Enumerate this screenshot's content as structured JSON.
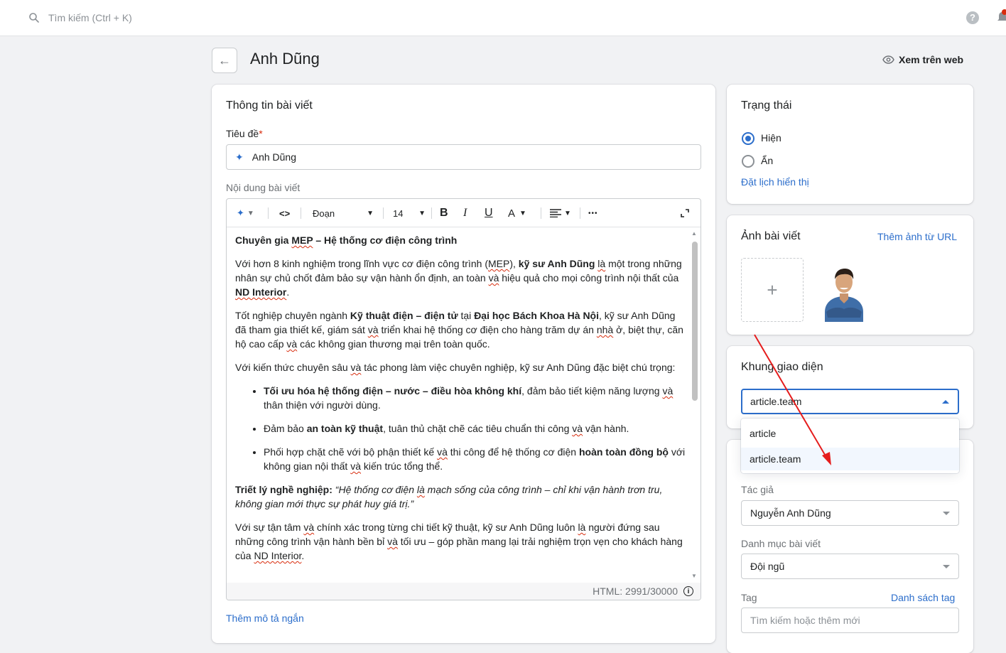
{
  "topbar": {
    "search_placeholder": "Tìm kiếm (Ctrl + K)",
    "help_glyph": "?"
  },
  "header": {
    "back_glyph": "←",
    "title": "Anh Dũng",
    "view_web": "Xem trên web"
  },
  "post_info": {
    "title": "Thông tin bài viết",
    "title_label": "Tiêu đề",
    "title_required": "*",
    "title_value": "Anh Dũng",
    "content_label": "Nội dung bài viết",
    "add_short_desc": "Thêm mô tả ngắn"
  },
  "editor": {
    "toolbar": {
      "ai_glyph": "✦",
      "code_glyph": "<>",
      "block_format": "Đoạn",
      "font_size": "14",
      "bold": "B",
      "italic": "I",
      "underline": "U",
      "color": "A",
      "more": "•••"
    },
    "counter": "HTML: 2991/30000",
    "body": {
      "p0_a": "Chuyên gia ",
      "p0_b": "MEP",
      "p0_c": " – Hệ thống cơ điện công trình",
      "p1_a": "Với hơn 8 kinh nghiệm trong lĩnh vực cơ điện công trình (",
      "p1_b": "MEP",
      "p1_c": "), ",
      "p1_d": "kỹ sư Anh Dũng",
      "p1_e": " ",
      "p1_f": "là",
      "p1_g": " một trong những nhân sự chủ chốt đảm bảo sự vận hành ổn định, an toàn ",
      "p1_h": "và",
      "p1_i": " hiệu quả cho mọi công trình nội thất của ",
      "p1_j": "ND Interior",
      "p1_k": ".",
      "p2_a": "Tốt nghiệp chuyên ngành ",
      "p2_b": "Kỹ thuật điện – điện tử",
      "p2_c": " tại ",
      "p2_d": "Đại học Bách Khoa Hà Nội",
      "p2_e": ", kỹ sư Anh Dũng đã tham gia thiết kế, giám sát ",
      "p2_f": "và",
      "p2_g": " triển khai hệ thống cơ điện cho hàng trăm dự án ",
      "p2_h": "nhà",
      "p2_i": " ở, biệt thự, căn hộ cao cấp ",
      "p2_j": "và",
      "p2_k": " các không gian thương mại trên toàn quốc.",
      "p3_a": "Với kiến thức chuyên sâu ",
      "p3_b": "và",
      "p3_c": " tác phong làm việc chuyên nghiệp, kỹ sư Anh Dũng đặc biệt chú trọng:",
      "li1_a": "Tối ưu hóa hệ thống điện – nước – điều hòa không khí",
      "li1_b": ", đảm bảo tiết kiệm năng lượng ",
      "li1_c": "và",
      "li1_d": " thân thiện với người dùng.",
      "li2_a": "Đảm bảo ",
      "li2_b": "an toàn kỹ thuật",
      "li2_c": ", tuân thủ chặt chẽ các tiêu chuẩn thi công ",
      "li2_d": "và",
      "li2_e": " vận hành.",
      "li3_a": "Phối hợp chặt chẽ với bộ phận thiết kế ",
      "li3_b": "và",
      "li3_c": " thi công để hệ thống cơ điện ",
      "li3_d": "hoàn toàn đồng bộ",
      "li3_e": " với không gian nội thất ",
      "li3_f": "và",
      "li3_g": " kiến trúc tổng thể.",
      "p4_a": "Triết lý nghề nghiệp:",
      "p4_b": " “Hệ thống cơ điện ",
      "p4_c": "là",
      "p4_d": " mạch sống của công trình – chỉ khi vận hành trơn tru, không gian mới thực sự phát huy giá trị.”",
      "p5_a": "Với sự tận tâm ",
      "p5_b": "và",
      "p5_c": " chính xác trong từng chi tiết kỹ thuật, kỹ sư Anh Dũng luôn ",
      "p5_d": "là",
      "p5_e": " người đứng sau những công trình vận hành bền bỉ ",
      "p5_f": "và",
      "p5_g": " tối ưu – góp phần mang lại trải nghiệm trọn vẹn cho khách hàng của ",
      "p5_h": "ND Interior",
      "p5_i": "."
    }
  },
  "status": {
    "title": "Trạng thái",
    "option_show": "Hiện",
    "option_hide": "Ẩn",
    "schedule": "Đặt lịch hiển thị",
    "selected": "Hiện"
  },
  "image": {
    "title": "Ảnh bài viết",
    "add_from_url": "Thêm ảnh từ URL",
    "add_glyph": "+"
  },
  "template": {
    "title": "Khung giao diện",
    "selected": "article.team",
    "options": [
      "article",
      "article.team"
    ]
  },
  "meta": {
    "author_label": "Tác giả",
    "author_value": "Nguyễn Anh Dũng",
    "category_label": "Danh mục bài viết",
    "category_value": "Đội ngũ",
    "tag_label": "Tag",
    "tag_list": "Danh sách tag",
    "tag_placeholder": "Tìm kiếm hoặc thêm mới"
  },
  "colors": {
    "accent": "#2c6ecb",
    "annotation_arrow": "#e51d1d"
  }
}
